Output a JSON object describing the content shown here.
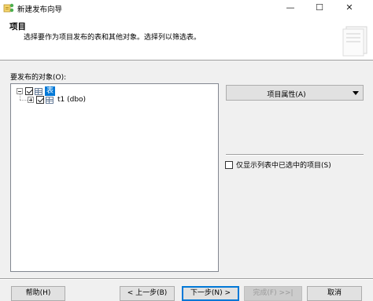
{
  "window": {
    "title": "新建发布向导",
    "minimize": "—",
    "maximize": "☐",
    "close": "✕"
  },
  "header": {
    "title": "项目",
    "description": "选择要作为项目发布的表和其他对象。选择列以筛选表。"
  },
  "objects": {
    "label": "要发布的对象(O):",
    "tree": [
      {
        "label": "表",
        "checked": true,
        "expanded": true,
        "selected": true,
        "icon": "table-icon"
      },
      {
        "label": "t1 (dbo)",
        "checked": true,
        "expanded": false,
        "selected": false,
        "icon": "table-icon"
      }
    ]
  },
  "properties_button": {
    "label": "项目属性(A)"
  },
  "show_only_checked": {
    "label": "仅显示列表中已选中的项目(S)",
    "checked": false
  },
  "buttons": {
    "help": "帮助(H)",
    "back": "< 上一步(B)",
    "next": "下一步(N) >",
    "finish": "完成(F) >>|",
    "cancel": "取消"
  },
  "colors": {
    "accent": "#0078d7",
    "dialog_bg": "#f0f0f0"
  }
}
